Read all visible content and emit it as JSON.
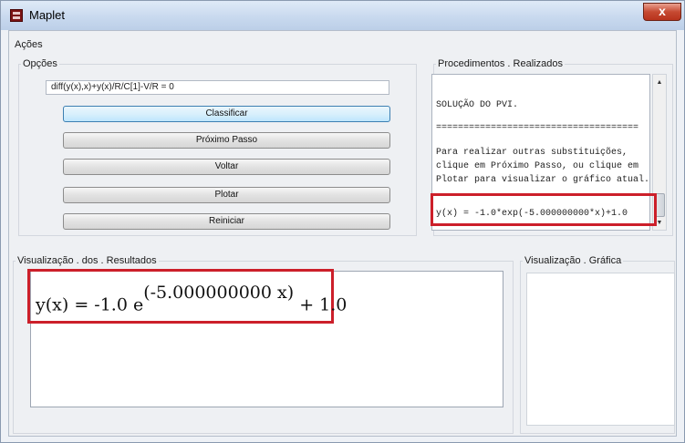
{
  "window": {
    "title": "Maplet",
    "close_label": "x"
  },
  "menu": {
    "label": "Ações"
  },
  "opcoes": {
    "legend": "Opções",
    "equation_value": "diff(y(x),x)+y(x)/R/C[1]-V/R = 0",
    "buttons": {
      "classificar": "Classificar",
      "proximo_passo": "Próximo Passo",
      "voltar": "Voltar",
      "plotar": "Plotar",
      "reiniciar": "Reiniciar"
    }
  },
  "procedimentos": {
    "legend": "Procedimentos . Realizados",
    "lines": [
      "SOLUÇÃO DO PVI.",
      "=====================================",
      "Para realizar outras substituições,",
      "clique em Próximo Passo, ou clique em",
      "Plotar para visualizar o gráfico atual.",
      "y(x) = -1.0*exp(-5.000000000*x)+1.0"
    ]
  },
  "resultados": {
    "legend": "Visualização . dos . Resultados",
    "formula_lhs": "y(x) = -1.0 e",
    "formula_exponent": "(-5.000000000 x)",
    "formula_rhs": "+ 1.0"
  },
  "grafica": {
    "legend": "Visualização . Gráfica"
  },
  "icons": {
    "app": "maplet-app-icon",
    "close": "close-icon",
    "scroll_up": "scroll-up-arrow-icon",
    "scroll_down": "scroll-down-arrow-icon"
  },
  "colors": {
    "highlight": "#cc1f2a",
    "close_button": "#c64a32"
  }
}
